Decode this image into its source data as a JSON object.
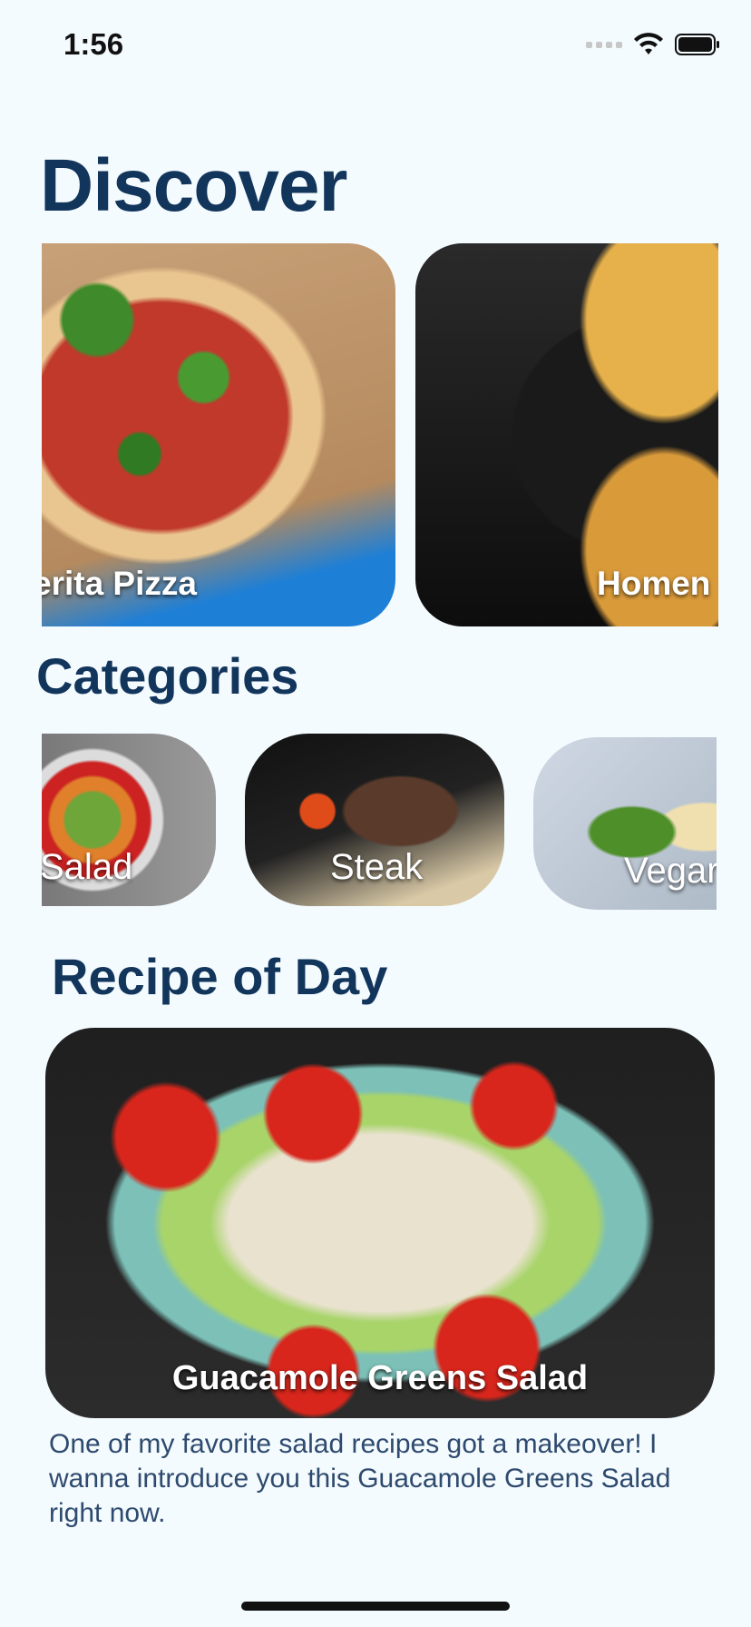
{
  "status_bar": {
    "time": "1:56",
    "icons": [
      "signal-icon",
      "wifi-icon",
      "battery-icon"
    ]
  },
  "discover": {
    "title": "Discover",
    "cards": [
      {
        "label": "erita Pizza"
      },
      {
        "label": "Homen"
      }
    ]
  },
  "categories": {
    "title": "Categories",
    "items": [
      {
        "label": "Salad"
      },
      {
        "label": "Steak"
      },
      {
        "label": "Vegar"
      }
    ]
  },
  "recipe_of_day": {
    "title": "Recipe of Day",
    "name": "Guacamole Greens Salad",
    "description": "One of my favorite salad recipes got a makeover! I wanna introduce you this Guacamole Greens Salad right now."
  }
}
